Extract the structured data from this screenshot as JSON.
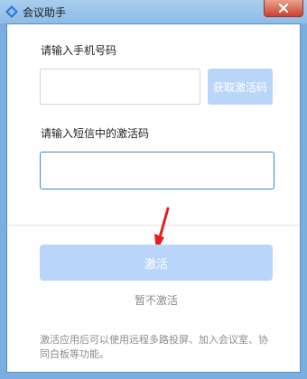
{
  "window": {
    "title": "会议助手",
    "app_icon": "meeting-assistant-logo",
    "close_icon": "close-icon"
  },
  "form": {
    "phone_label": "请输入手机号码",
    "phone_value": "",
    "get_code_label": "获取激活码",
    "code_label": "请输入短信中的激活码",
    "code_value": "",
    "activate_label": "激活",
    "skip_label": "暂不激活"
  },
  "footer": {
    "note": "激活应用后可以使用远程多路投屏、加入会议室、协同白板等功能。"
  },
  "colors": {
    "accent": "#3a87d6",
    "button_disabled": "#b9d6fa",
    "annotation_arrow": "#e2221e"
  }
}
